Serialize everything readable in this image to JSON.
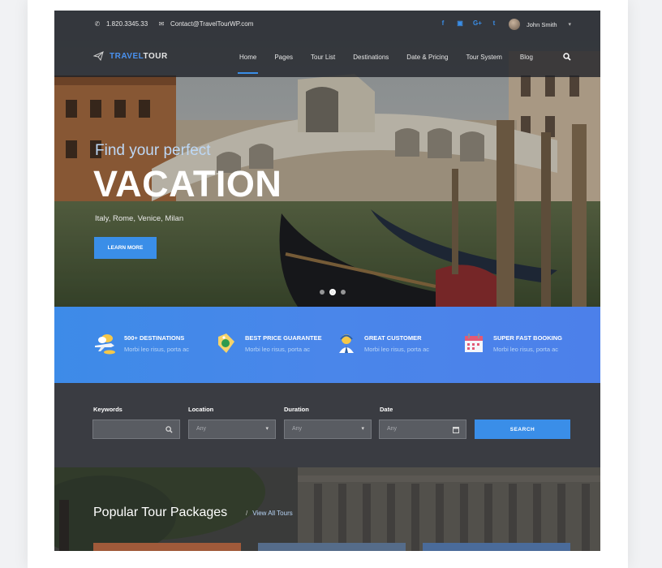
{
  "topbar": {
    "phone": "1.820.3345.33",
    "email": "Contact@TravelTourWP.com",
    "social_icons": [
      "facebook-icon",
      "flickr-icon",
      "google-plus-icon",
      "twitter-icon"
    ],
    "social_glyphs": [
      "f",
      "▣",
      "G+",
      "t"
    ],
    "user_name": "John Smith"
  },
  "logo": {
    "part1": "TRAVEL",
    "part2": "TOUR"
  },
  "nav": {
    "items": [
      "Home",
      "Pages",
      "Tour List",
      "Destinations",
      "Date & Pricing",
      "Tour System",
      "Blog"
    ],
    "active": "Home"
  },
  "hero": {
    "tagline": "Find your perfect",
    "headline": "VACATION",
    "subtitle": "Italy, Rome, Venice, Milan",
    "button": "LEARN MORE",
    "slides": 3,
    "active_slide": 2
  },
  "features": [
    {
      "title": "500+ DESTINATIONS",
      "subtitle": "Morbi leo risus, porta ac",
      "icon": "airplane-clouds-icon"
    },
    {
      "title": "BEST PRICE GUARANTEE",
      "subtitle": "Morbi leo risus, porta ac",
      "icon": "price-tag-icon"
    },
    {
      "title": "GREAT CUSTOMER",
      "subtitle": "Morbi leo risus, porta ac",
      "icon": "customer-support-icon"
    },
    {
      "title": "SUPER FAST BOOKING",
      "subtitle": "Morbi leo risus, porta ac",
      "icon": "calendar-icon"
    }
  ],
  "search": {
    "keywords_label": "Keywords",
    "location_label": "Location",
    "location_value": "Any",
    "duration_label": "Duration",
    "duration_value": "Any",
    "date_label": "Date",
    "date_placeholder": "Any",
    "button": "SEARCH"
  },
  "popular": {
    "title": "Popular Tour Packages",
    "link": "View All Tours"
  },
  "colors": {
    "accent": "#3a8ee8",
    "features_bg": "#4a86ea",
    "search_bg": "#3a3c42"
  }
}
